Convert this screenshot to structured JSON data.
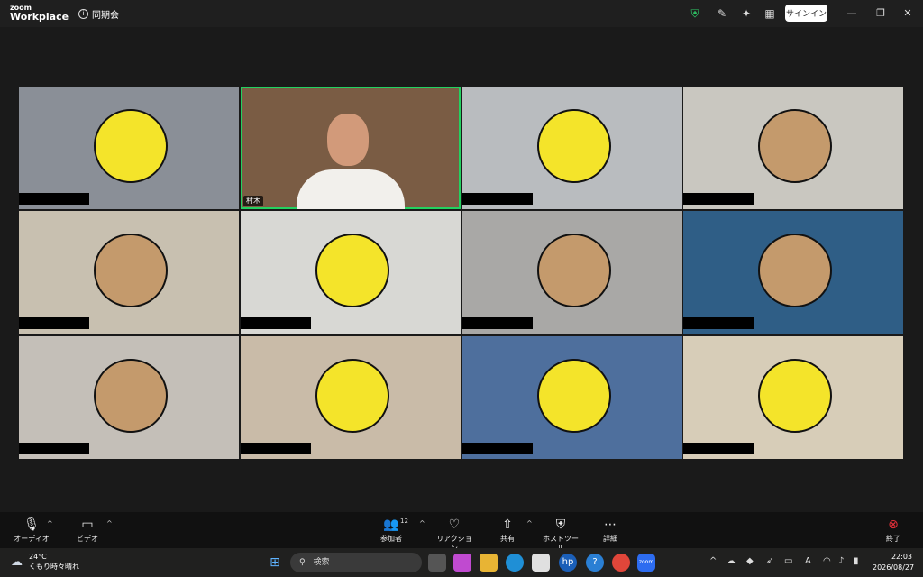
{
  "titlebar": {
    "brand_top": "zoom",
    "brand_bottom": "Workplace",
    "meeting_name": "同期会",
    "signin_label": "サインイン"
  },
  "tiles": [
    {
      "name": "participant-1",
      "bg": "#8a8f97",
      "face": "smile",
      "label": ""
    },
    {
      "name": "participant-2",
      "bg": "#7a5c44",
      "face": "none",
      "label": "村木",
      "active": true
    },
    {
      "name": "participant-3",
      "bg": "#b9bcbf",
      "face": "smile",
      "label": ""
    },
    {
      "name": "participant-4",
      "bg": "#c9c7c0",
      "face": "laugh",
      "label": ""
    },
    {
      "name": "participant-5",
      "bg": "#c8c0b0",
      "face": "laugh",
      "label": ""
    },
    {
      "name": "participant-6",
      "bg": "#d8d8d4",
      "face": "smile",
      "label": ""
    },
    {
      "name": "participant-7",
      "bg": "#a9a8a6",
      "face": "laugh",
      "label": ""
    },
    {
      "name": "participant-8",
      "bg": "#2f5e86",
      "face": "laugh",
      "label": ""
    },
    {
      "name": "participant-9",
      "bg": "#c4bfb8",
      "face": "laugh",
      "label": ""
    },
    {
      "name": "participant-10",
      "bg": "#c9bba8",
      "face": "smile",
      "label": ""
    },
    {
      "name": "participant-11",
      "bg": "#4e6f9d",
      "face": "smile",
      "label": ""
    },
    {
      "name": "participant-12",
      "bg": "#d7cdb8",
      "face": "smile",
      "label": ""
    }
  ],
  "toolbar": {
    "audio": "オーディオ",
    "video": "ビデオ",
    "participants": "参加者",
    "participants_count": "12",
    "reactions": "リアクション",
    "share": "共有",
    "host_tools": "ホストツール",
    "more": "詳細",
    "end": "終了"
  },
  "taskbar": {
    "temperature": "24°C",
    "weather": "くもり時々晴れ",
    "search_placeholder": "検索",
    "ime": "A",
    "time": "22:03",
    "date": "2026/08/27"
  }
}
